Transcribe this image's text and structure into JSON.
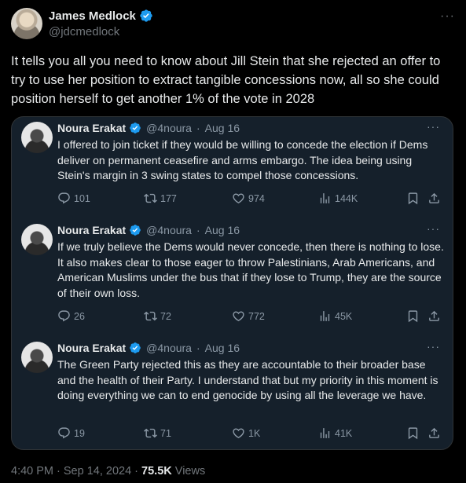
{
  "author": {
    "name": "James Medlock",
    "handle": "@jdcmedlock",
    "more": "···"
  },
  "tweet": {
    "text": "It tells you all you need to know about Jill Stein that she rejected an offer to try to use her position to extract tangible concessions now, all so she could position herself to get another 1% of the vote in 2028"
  },
  "quoted_thread": [
    {
      "name": "Noura Erakat",
      "handle": "@4noura",
      "sep": "·",
      "date": "Aug 16",
      "more": "···",
      "text": "I offered to join ticket if they would be willing to concede the election if Dems deliver on permanent ceasefire and arms embargo. The idea being using Stein's margin in 3 swing states to compel those concessions.",
      "replies": "101",
      "reposts": "177",
      "likes": "974",
      "views": "144K"
    },
    {
      "name": "Noura Erakat",
      "handle": "@4noura",
      "sep": "·",
      "date": "Aug 16",
      "more": "···",
      "text": "If we truly believe the Dems would never concede, then there is nothing to lose. It also makes clear to those eager to throw Palestinians, Arab Americans, and American Muslims under the bus that if they lose to Trump, they are the source of their own loss.",
      "replies": "26",
      "reposts": "72",
      "likes": "772",
      "views": "45K"
    },
    {
      "name": "Noura Erakat",
      "handle": "@4noura",
      "sep": "·",
      "date": "Aug 16",
      "more": "···",
      "text": "The Green Party rejected this as they are accountable to their broader base and the health of their Party. I understand that but my priority in this moment is doing everything we can to end genocide by using all the leverage we have.",
      "replies": "19",
      "reposts": "71",
      "likes": "1K",
      "views": "41K"
    }
  ],
  "footer": {
    "time": "4:40 PM · Sep 14, 2024 · ",
    "views_count": "75.5K",
    "views_label": " Views"
  },
  "colors": {
    "background": "#000000",
    "quote_background": "#15202b",
    "verified": "#1d9bf0",
    "text": "#e7e9ea",
    "muted": "#71767b"
  }
}
